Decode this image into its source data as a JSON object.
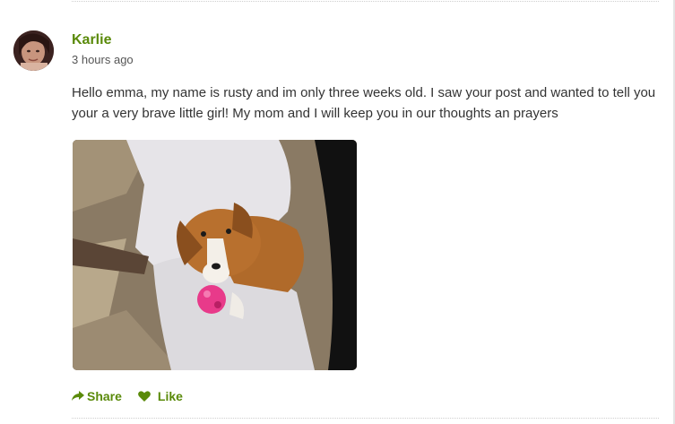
{
  "post": {
    "author": "Karlie",
    "timestamp": "3 hours ago",
    "text": "Hello emma, my name is rusty and im only three weeks old. I saw your post and wanted to tell you your a very brave little girl! My mom and I will keep you in our thoughts an prayers"
  },
  "actions": {
    "share_label": "Share",
    "share_icon": "share-icon",
    "like_label": "Like",
    "like_icon": "heart-icon"
  },
  "colors": {
    "accent": "#5a8a0a",
    "text": "#333333",
    "muted": "#555555"
  }
}
